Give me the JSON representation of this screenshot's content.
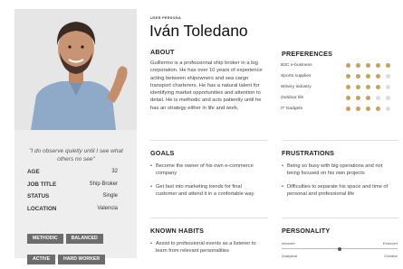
{
  "persona": {
    "kicker": "USER PERSONA",
    "name": "Iván Toledano",
    "quote": "\"I do observe quietly until I see what others no see\"",
    "facts": [
      {
        "label": "AGE",
        "value": "32"
      },
      {
        "label": "JOB TITLE",
        "value": "Ship Broker"
      },
      {
        "label": "STATUS",
        "value": "Single"
      },
      {
        "label": "LOCATION",
        "value": "Valencia"
      }
    ],
    "tags": [
      "METHODIC",
      "BALANCED",
      "ACTIVE",
      "HARD WORKER"
    ]
  },
  "about": {
    "heading": "ABOUT",
    "text": "Guillermo is a professional ship broker in a big corporation. He has over 10 years of experience acting between shipowners and sea cargo transport charterers. He has a natural talent for identifying market opportunities and attention to detail. He is methodic and acts patiently until he has an strategy either in life and work."
  },
  "preferences": {
    "heading": "PREFERENCES",
    "items": [
      {
        "label": "B2C e-business",
        "rating": 5,
        "max": 5
      },
      {
        "label": "Sports supplies",
        "rating": 4,
        "max": 5
      },
      {
        "label": "Winery industry",
        "rating": 4,
        "max": 5
      },
      {
        "label": "Outdoor life",
        "rating": 3,
        "max": 5
      },
      {
        "label": "IT Gadgets",
        "rating": 4,
        "max": 5
      }
    ]
  },
  "goals": {
    "heading": "GOALS",
    "items": [
      "Become the owner of his own e-commerce company",
      "Get fast into marketing trends for final customer and attend it in a confortable way"
    ]
  },
  "frustrations": {
    "heading": "FRUSTRATIONS",
    "items": [
      "Being so busy with big operations and not being focused on his own projects",
      "Difficulties to separate his space and time of personal and professional life"
    ]
  },
  "habits": {
    "heading": "KNOWN HABITS",
    "items": [
      "Assist to professional events as a listener to learn from relevant personalities"
    ]
  },
  "personality": {
    "heading": "PERSONALITY",
    "sliders": [
      {
        "left": "Introvert",
        "right": "Extrovert",
        "value": 0.5
      },
      {
        "left": "Analytical",
        "right": "Creative",
        "value": 0.85
      }
    ]
  },
  "colors": {
    "accent": "#c6a15b",
    "tag_bg": "#6d6d6d",
    "panel_bg": "#eeeeee"
  }
}
